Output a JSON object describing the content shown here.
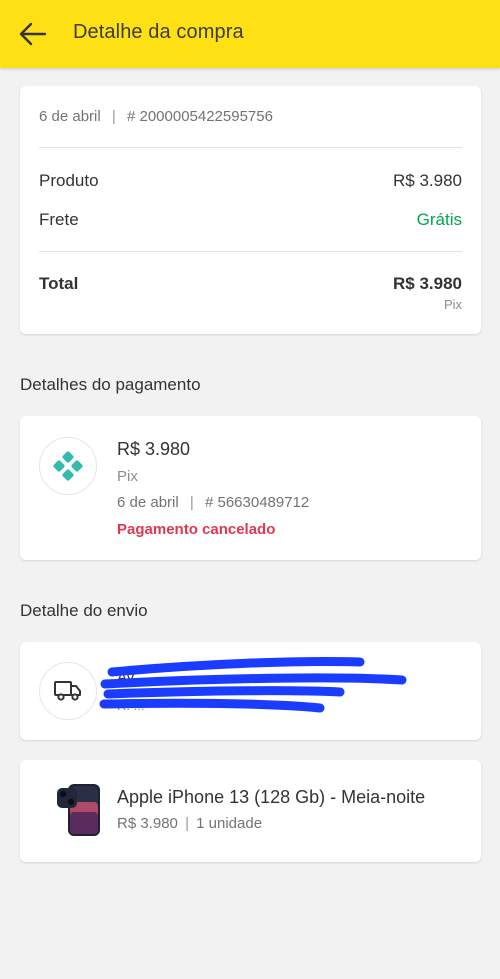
{
  "header": {
    "title": "Detalhe da compra",
    "back_icon": "arrow-left-icon",
    "color": "#ffe014"
  },
  "summary": {
    "date": "6 de abril",
    "order_number": "# 2000005422595756",
    "product_label": "Produto",
    "product_value": "R$ 3.980",
    "shipping_label": "Frete",
    "shipping_value": "Grátis",
    "total_label": "Total",
    "total_value": "R$ 3.980",
    "total_method": "Pix"
  },
  "payment": {
    "section_title": "Detalhes do pagamento",
    "icon": "pix-icon",
    "amount": "R$ 3.980",
    "method": "Pix",
    "date": "6 de abril",
    "transaction_number": "# 56630489712",
    "status": "Pagamento cancelado",
    "status_color": "#e0384f"
  },
  "shipping": {
    "section_title": "Detalhe do envio",
    "icon": "truck-icon",
    "address_line1": "Av. ...",
    "address_line2": "R. ...",
    "redacted": true
  },
  "item": {
    "title": "Apple iPhone 13 (128 Gb) - Meia-noite",
    "price": "R$ 3.980",
    "quantity": "1 unidade",
    "thumbnail": "iphone-thumbnail"
  },
  "colors": {
    "accent_yellow": "#ffe014",
    "success_green": "#00a650",
    "error_red": "#e0384f",
    "pix_teal": "#32bcad",
    "redaction_blue": "#1a3cff"
  }
}
